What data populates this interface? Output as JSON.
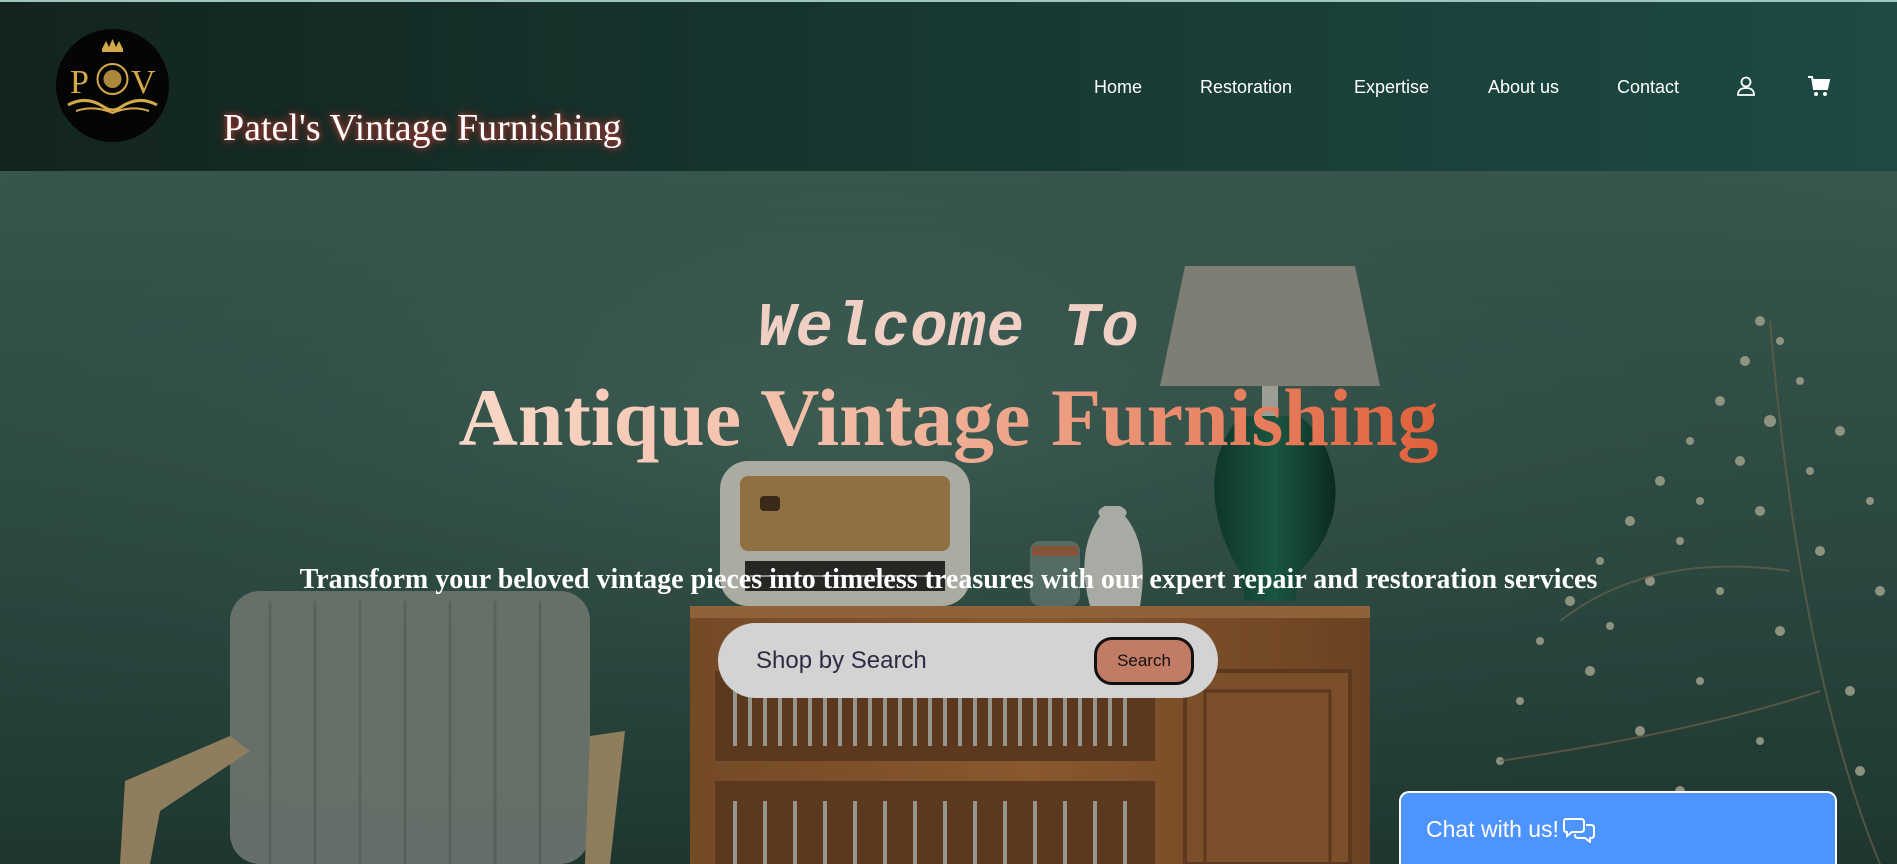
{
  "brand": {
    "logo_letters": "POV",
    "name": "Patel's Vintage Furnishing"
  },
  "nav": {
    "items": [
      "Home",
      "Restoration",
      "Expertise",
      "About us",
      "Contact"
    ],
    "icons": [
      "user-icon",
      "cart-icon"
    ]
  },
  "hero": {
    "welcome": "Welcome To",
    "headline": "Antique Vintage Furnishing",
    "tagline": "Transform your beloved vintage pieces into timeless treasures with our expert repair and restoration services",
    "search": {
      "placeholder": "Shop by Search",
      "button_label": "Search"
    }
  },
  "chat": {
    "label": "Chat with us!",
    "icon": "chat-bubbles-icon"
  },
  "colors": {
    "header_bg": "#183832",
    "accent": "#c27c66",
    "headline": "#ef9d80",
    "chat": "#4d94ff"
  }
}
